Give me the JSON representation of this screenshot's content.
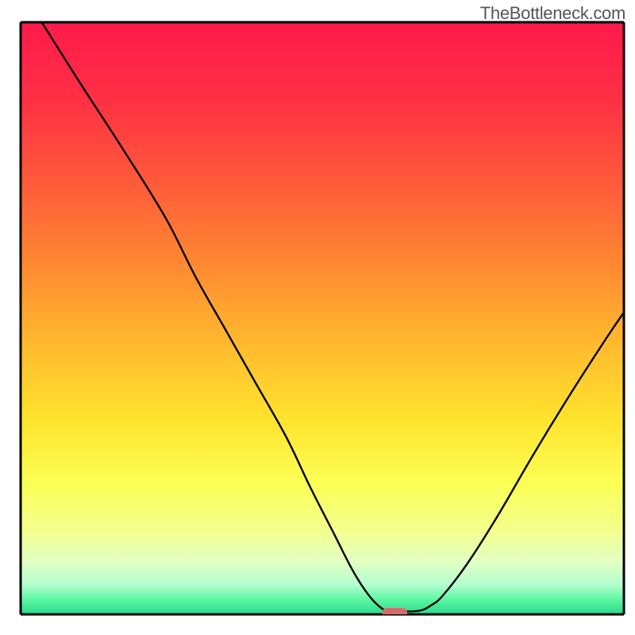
{
  "watermark": "TheBottleneck.com",
  "chart_data": {
    "type": "line",
    "title": "",
    "xlabel": "",
    "ylabel": "",
    "xlim": [
      0,
      100
    ],
    "ylim": [
      0,
      100
    ],
    "grid": false,
    "legend": false,
    "background_gradient": {
      "stops": [
        {
          "offset": 0.0,
          "color": "#ff1a4b"
        },
        {
          "offset": 0.13,
          "color": "#ff3044"
        },
        {
          "offset": 0.27,
          "color": "#ff5a3a"
        },
        {
          "offset": 0.4,
          "color": "#ff8532"
        },
        {
          "offset": 0.53,
          "color": "#ffb52e"
        },
        {
          "offset": 0.67,
          "color": "#ffe32e"
        },
        {
          "offset": 0.78,
          "color": "#fbff55"
        },
        {
          "offset": 0.86,
          "color": "#f3ff8e"
        },
        {
          "offset": 0.91,
          "color": "#e3ffc2"
        },
        {
          "offset": 0.95,
          "color": "#b4ffcf"
        },
        {
          "offset": 0.975,
          "color": "#5cf7a3"
        },
        {
          "offset": 1.0,
          "color": "#29d98c"
        }
      ]
    },
    "series": [
      {
        "name": "bottleneck-curve",
        "x": [
          3.5,
          10,
          17,
          24,
          29,
          34,
          39,
          44,
          48,
          52,
          55,
          57.5,
          59.5,
          61,
          62.5,
          66,
          68,
          70,
          74,
          79,
          85,
          91,
          97,
          100
        ],
        "y": [
          100,
          89.5,
          78.5,
          67,
          57,
          48,
          39,
          30,
          21.5,
          13.5,
          7.5,
          3.5,
          1.3,
          0.5,
          0.5,
          0.6,
          1.5,
          3.2,
          8.5,
          16.5,
          27,
          37,
          46.5,
          51
        ]
      }
    ],
    "marker": {
      "name": "optimal-point",
      "x": 62,
      "y": 0,
      "width": 4.2,
      "height": 1.6,
      "color": "#d46a6a"
    },
    "axes": {
      "stroke": "#000000",
      "stroke_width": 3
    }
  }
}
